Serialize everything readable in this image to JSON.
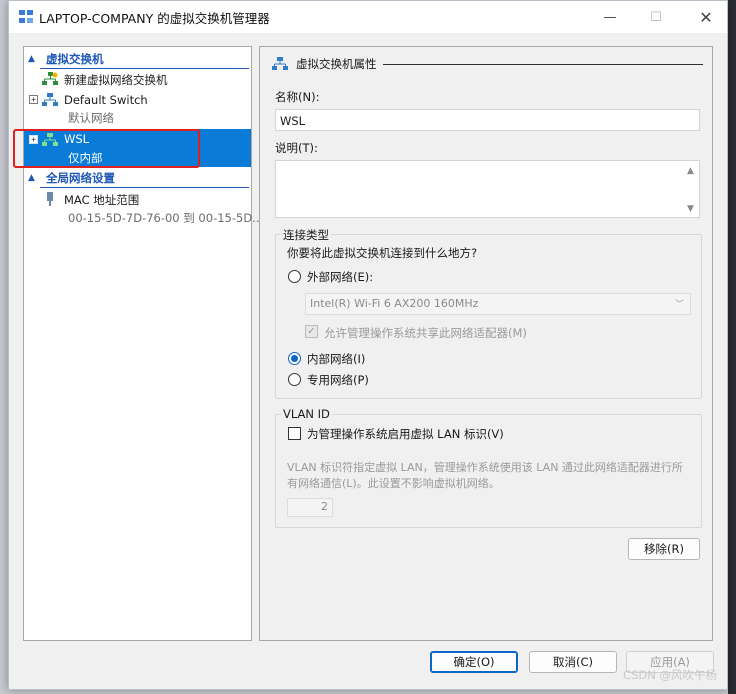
{
  "window": {
    "title": "LAPTOP-COMPANY 的虚拟交换机管理器",
    "minimize_glyph": "—",
    "maximize_glyph": "☐",
    "close_glyph": "✕"
  },
  "tree": {
    "switches_header": "虚拟交换机",
    "new_switch": "新建虚拟网络交换机",
    "default_switch": {
      "label": "Default Switch",
      "sub": "默认网络"
    },
    "wsl_switch": {
      "label": "WSL",
      "sub": "仅内部"
    },
    "global_header": "全局网络设置",
    "mac_range": {
      "label": "MAC 地址范围",
      "sub": "00-15-5D-7D-76-00 到 00-15-5D..."
    }
  },
  "props": {
    "section_title": "虚拟交换机属性",
    "name_label": "名称(N):",
    "name_value": "WSL",
    "desc_label": "说明(T):",
    "desc_value": "",
    "conn_group_title": "连接类型",
    "conn_question": "你要将此虚拟交换机连接到什么地方?",
    "external_label": "外部网络(E):",
    "adapter_value": "Intel(R) Wi-Fi 6 AX200 160MHz",
    "allow_share_label": "允许管理操作系统共享此网络适配器(M)",
    "internal_label": "内部网络(I)",
    "private_label": "专用网络(P)",
    "selected_connection": "internal",
    "vlan_group_title": "VLAN ID",
    "vlan_enable_label": "为管理操作系统启用虚拟 LAN 标识(V)",
    "vlan_desc_line1": "VLAN 标识符指定虚拟 LAN，管理操作系统使用该 LAN 通过此网络适配器进行所",
    "vlan_desc_line2": "有网络通信(L)。此设置不影响虚拟机网络。",
    "vlan_value": "2",
    "remove_button": "移除(R)"
  },
  "footer": {
    "ok_button": "确定(O)",
    "cancel_button": "取消(C)",
    "apply_button": "应用(A)",
    "watermark": "CSDN @风吹午杨"
  },
  "colors": {
    "accent": "#0a7bd7",
    "header_blue": "#1f57b6",
    "highlight_box": "#e02020"
  }
}
